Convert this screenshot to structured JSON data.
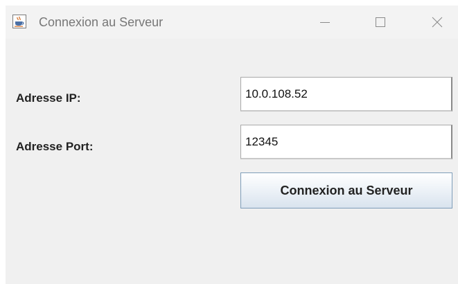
{
  "window": {
    "title": "Connexion au Serveur",
    "app_icon": "java-coffee-cup-icon",
    "controls": {
      "minimize_icon": "minimize-icon",
      "maximize_icon": "maximize-icon",
      "close_icon": "close-icon"
    }
  },
  "form": {
    "ip_label": "Adresse IP:",
    "ip_value": "10.0.108.52",
    "port_label": "Adresse Port:",
    "port_value": "12345",
    "connect_label": "Connexion au Serveur"
  },
  "colors": {
    "window_bg": "#f0f0f0",
    "titlebar_bg": "#f3f3f3",
    "button_border": "#7e9db9"
  }
}
